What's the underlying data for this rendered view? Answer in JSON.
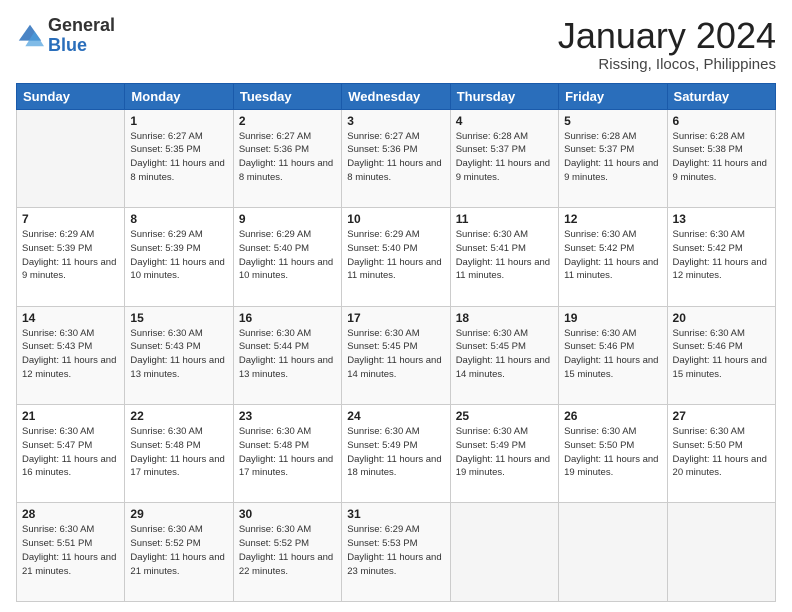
{
  "logo": {
    "general": "General",
    "blue": "Blue"
  },
  "header": {
    "title": "January 2024",
    "subtitle": "Rissing, Ilocos, Philippines"
  },
  "weekdays": [
    "Sunday",
    "Monday",
    "Tuesday",
    "Wednesday",
    "Thursday",
    "Friday",
    "Saturday"
  ],
  "weeks": [
    [
      {
        "day": "",
        "sunrise": "",
        "sunset": "",
        "daylight": ""
      },
      {
        "day": "1",
        "sunrise": "Sunrise: 6:27 AM",
        "sunset": "Sunset: 5:35 PM",
        "daylight": "Daylight: 11 hours and 8 minutes."
      },
      {
        "day": "2",
        "sunrise": "Sunrise: 6:27 AM",
        "sunset": "Sunset: 5:36 PM",
        "daylight": "Daylight: 11 hours and 8 minutes."
      },
      {
        "day": "3",
        "sunrise": "Sunrise: 6:27 AM",
        "sunset": "Sunset: 5:36 PM",
        "daylight": "Daylight: 11 hours and 8 minutes."
      },
      {
        "day": "4",
        "sunrise": "Sunrise: 6:28 AM",
        "sunset": "Sunset: 5:37 PM",
        "daylight": "Daylight: 11 hours and 9 minutes."
      },
      {
        "day": "5",
        "sunrise": "Sunrise: 6:28 AM",
        "sunset": "Sunset: 5:37 PM",
        "daylight": "Daylight: 11 hours and 9 minutes."
      },
      {
        "day": "6",
        "sunrise": "Sunrise: 6:28 AM",
        "sunset": "Sunset: 5:38 PM",
        "daylight": "Daylight: 11 hours and 9 minutes."
      }
    ],
    [
      {
        "day": "7",
        "sunrise": "Sunrise: 6:29 AM",
        "sunset": "Sunset: 5:39 PM",
        "daylight": "Daylight: 11 hours and 9 minutes."
      },
      {
        "day": "8",
        "sunrise": "Sunrise: 6:29 AM",
        "sunset": "Sunset: 5:39 PM",
        "daylight": "Daylight: 11 hours and 10 minutes."
      },
      {
        "day": "9",
        "sunrise": "Sunrise: 6:29 AM",
        "sunset": "Sunset: 5:40 PM",
        "daylight": "Daylight: 11 hours and 10 minutes."
      },
      {
        "day": "10",
        "sunrise": "Sunrise: 6:29 AM",
        "sunset": "Sunset: 5:40 PM",
        "daylight": "Daylight: 11 hours and 11 minutes."
      },
      {
        "day": "11",
        "sunrise": "Sunrise: 6:30 AM",
        "sunset": "Sunset: 5:41 PM",
        "daylight": "Daylight: 11 hours and 11 minutes."
      },
      {
        "day": "12",
        "sunrise": "Sunrise: 6:30 AM",
        "sunset": "Sunset: 5:42 PM",
        "daylight": "Daylight: 11 hours and 11 minutes."
      },
      {
        "day": "13",
        "sunrise": "Sunrise: 6:30 AM",
        "sunset": "Sunset: 5:42 PM",
        "daylight": "Daylight: 11 hours and 12 minutes."
      }
    ],
    [
      {
        "day": "14",
        "sunrise": "Sunrise: 6:30 AM",
        "sunset": "Sunset: 5:43 PM",
        "daylight": "Daylight: 11 hours and 12 minutes."
      },
      {
        "day": "15",
        "sunrise": "Sunrise: 6:30 AM",
        "sunset": "Sunset: 5:43 PM",
        "daylight": "Daylight: 11 hours and 13 minutes."
      },
      {
        "day": "16",
        "sunrise": "Sunrise: 6:30 AM",
        "sunset": "Sunset: 5:44 PM",
        "daylight": "Daylight: 11 hours and 13 minutes."
      },
      {
        "day": "17",
        "sunrise": "Sunrise: 6:30 AM",
        "sunset": "Sunset: 5:45 PM",
        "daylight": "Daylight: 11 hours and 14 minutes."
      },
      {
        "day": "18",
        "sunrise": "Sunrise: 6:30 AM",
        "sunset": "Sunset: 5:45 PM",
        "daylight": "Daylight: 11 hours and 14 minutes."
      },
      {
        "day": "19",
        "sunrise": "Sunrise: 6:30 AM",
        "sunset": "Sunset: 5:46 PM",
        "daylight": "Daylight: 11 hours and 15 minutes."
      },
      {
        "day": "20",
        "sunrise": "Sunrise: 6:30 AM",
        "sunset": "Sunset: 5:46 PM",
        "daylight": "Daylight: 11 hours and 15 minutes."
      }
    ],
    [
      {
        "day": "21",
        "sunrise": "Sunrise: 6:30 AM",
        "sunset": "Sunset: 5:47 PM",
        "daylight": "Daylight: 11 hours and 16 minutes."
      },
      {
        "day": "22",
        "sunrise": "Sunrise: 6:30 AM",
        "sunset": "Sunset: 5:48 PM",
        "daylight": "Daylight: 11 hours and 17 minutes."
      },
      {
        "day": "23",
        "sunrise": "Sunrise: 6:30 AM",
        "sunset": "Sunset: 5:48 PM",
        "daylight": "Daylight: 11 hours and 17 minutes."
      },
      {
        "day": "24",
        "sunrise": "Sunrise: 6:30 AM",
        "sunset": "Sunset: 5:49 PM",
        "daylight": "Daylight: 11 hours and 18 minutes."
      },
      {
        "day": "25",
        "sunrise": "Sunrise: 6:30 AM",
        "sunset": "Sunset: 5:49 PM",
        "daylight": "Daylight: 11 hours and 19 minutes."
      },
      {
        "day": "26",
        "sunrise": "Sunrise: 6:30 AM",
        "sunset": "Sunset: 5:50 PM",
        "daylight": "Daylight: 11 hours and 19 minutes."
      },
      {
        "day": "27",
        "sunrise": "Sunrise: 6:30 AM",
        "sunset": "Sunset: 5:50 PM",
        "daylight": "Daylight: 11 hours and 20 minutes."
      }
    ],
    [
      {
        "day": "28",
        "sunrise": "Sunrise: 6:30 AM",
        "sunset": "Sunset: 5:51 PM",
        "daylight": "Daylight: 11 hours and 21 minutes."
      },
      {
        "day": "29",
        "sunrise": "Sunrise: 6:30 AM",
        "sunset": "Sunset: 5:52 PM",
        "daylight": "Daylight: 11 hours and 21 minutes."
      },
      {
        "day": "30",
        "sunrise": "Sunrise: 6:30 AM",
        "sunset": "Sunset: 5:52 PM",
        "daylight": "Daylight: 11 hours and 22 minutes."
      },
      {
        "day": "31",
        "sunrise": "Sunrise: 6:29 AM",
        "sunset": "Sunset: 5:53 PM",
        "daylight": "Daylight: 11 hours and 23 minutes."
      },
      {
        "day": "",
        "sunrise": "",
        "sunset": "",
        "daylight": ""
      },
      {
        "day": "",
        "sunrise": "",
        "sunset": "",
        "daylight": ""
      },
      {
        "day": "",
        "sunrise": "",
        "sunset": "",
        "daylight": ""
      }
    ]
  ]
}
